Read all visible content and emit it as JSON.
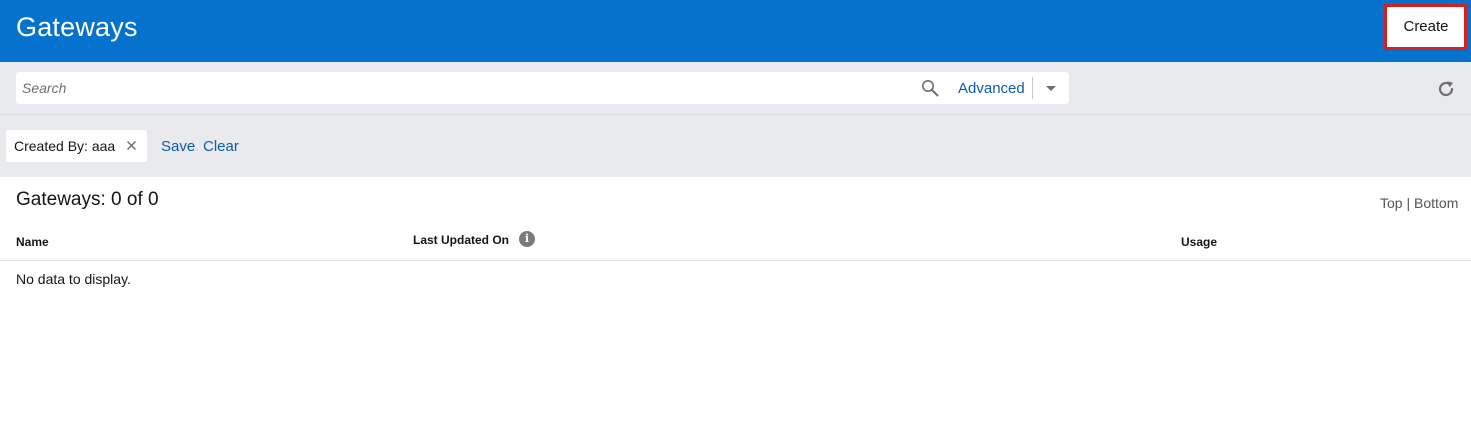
{
  "header": {
    "title": "Gateways",
    "create_label": "Create",
    "background_color": "#0572ce",
    "highlight_color": "#d6201b"
  },
  "search": {
    "placeholder": "Search",
    "value": "",
    "advanced_label": "Advanced",
    "search_icon": "magnifier-icon",
    "dropdown_icon": "chevron-down-icon",
    "refresh_icon": "refresh-icon"
  },
  "filters": {
    "chip_label": "Created By: aaa",
    "chip_close_icon": "close-icon",
    "save_label": "Save",
    "clear_label": "Clear"
  },
  "results": {
    "count_label": "Gateways: 0 of 0",
    "top_label": "Top",
    "separator": "|",
    "bottom_label": "Bottom",
    "columns": {
      "name": "Name",
      "last_updated": "Last Updated On",
      "usage": "Usage"
    },
    "info_icon_glyph": "i",
    "empty_message": "No data to display."
  }
}
